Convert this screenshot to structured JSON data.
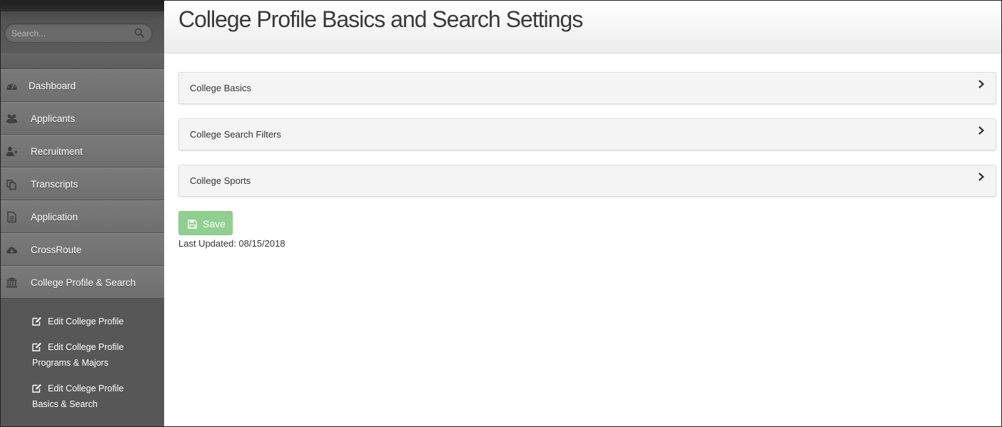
{
  "search": {
    "placeholder": "Search..."
  },
  "nav": {
    "items": [
      {
        "label": "Dashboard",
        "icon": "dashboard-icon"
      },
      {
        "label": "Applicants",
        "icon": "users-icon"
      },
      {
        "label": "Recruitment",
        "icon": "user-plus-icon"
      },
      {
        "label": "Transcripts",
        "icon": "copy-icon"
      },
      {
        "label": "Application",
        "icon": "file-text-icon"
      },
      {
        "label": "CrossRoute",
        "icon": "cloud-download-icon"
      },
      {
        "label": "College Profile & Search",
        "icon": "bank-icon"
      }
    ],
    "subitems": [
      {
        "line1": "Edit College Profile",
        "line2": ""
      },
      {
        "line1": "Edit College Profile",
        "line2": "Programs & Majors"
      },
      {
        "line1": "Edit College Profile",
        "line2": "Basics & Search"
      }
    ]
  },
  "header": {
    "title": "College Profile Basics and Search Settings"
  },
  "panels": [
    {
      "title": "College Basics"
    },
    {
      "title": "College Search Filters"
    },
    {
      "title": "College Sports"
    }
  ],
  "save": {
    "label": "Save"
  },
  "last_updated": "Last Updated: 08/15/2018",
  "colors": {
    "sidebar": "#5a5a5a",
    "nav_item": "#737373",
    "save_button": "#90cf8f",
    "title_text": "#3a3a3a"
  }
}
